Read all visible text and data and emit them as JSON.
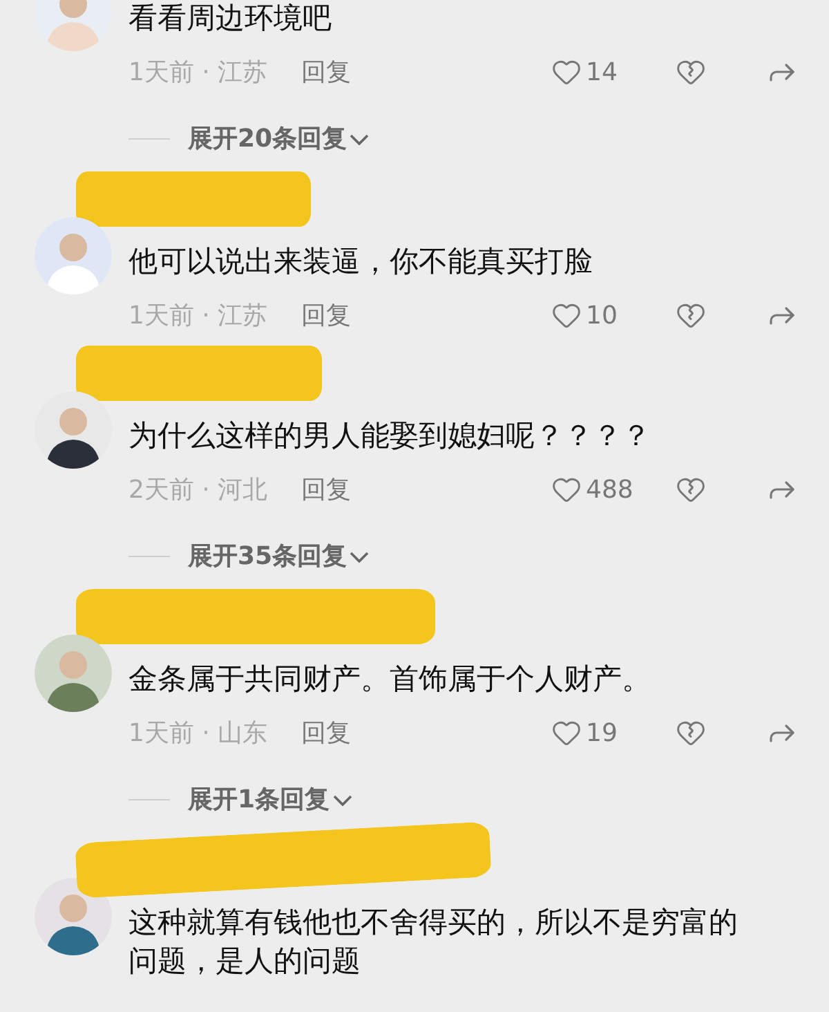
{
  "comments": [
    {
      "name_redacted": false,
      "text": "看看周边环境吧",
      "time_place": "1天前 · 江苏",
      "reply": "回复",
      "likes": "14",
      "expand": "展开20条回复"
    },
    {
      "name_redacted": true,
      "text": "他可以说出来装逼，你不能真买打脸",
      "time_place": "1天前 · 江苏",
      "reply": "回复",
      "likes": "10"
    },
    {
      "name_redacted": true,
      "text": "为什么这样的男人能娶到媳妇呢？？？？",
      "time_place": "2天前 · 河北",
      "reply": "回复",
      "likes": "488",
      "expand": "展开35条回复"
    },
    {
      "name_redacted": true,
      "text": "金条属于共同财产。首饰属于个人财产。",
      "time_place": "1天前 · 山东",
      "reply": "回复",
      "likes": "19",
      "expand": "展开1条回复"
    },
    {
      "name_redacted": true,
      "text": "这种就算有钱他也不舍得买的，所以不是穷富的问题，是人的问题"
    }
  ]
}
